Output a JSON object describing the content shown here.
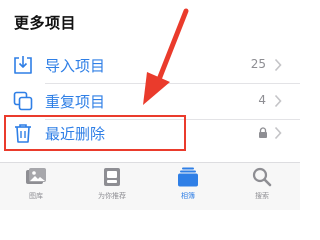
{
  "section": {
    "title": "更多项目"
  },
  "rows": [
    {
      "label": "导入项目",
      "count": "25",
      "icon": "import-icon"
    },
    {
      "label": "重复项目",
      "count": "4",
      "icon": "duplicate-icon"
    },
    {
      "label": "最近删除",
      "icon": "trash-icon",
      "locked": true
    }
  ],
  "tabbar": {
    "tabs": [
      {
        "label": "图库",
        "icon": "photo-library-icon",
        "active": false
      },
      {
        "label": "为你推荐",
        "icon": "for-you-icon",
        "active": false
      },
      {
        "label": "相簿",
        "icon": "albums-icon",
        "active": true
      },
      {
        "label": "搜索",
        "icon": "search-icon",
        "active": false
      }
    ]
  },
  "colors": {
    "accent": "#2f7fe6",
    "annotation": "#ea3b2c",
    "secondary_text": "#8e8e93",
    "divider": "#e3e3e6",
    "tabbar_bg": "#f7f7f7"
  }
}
